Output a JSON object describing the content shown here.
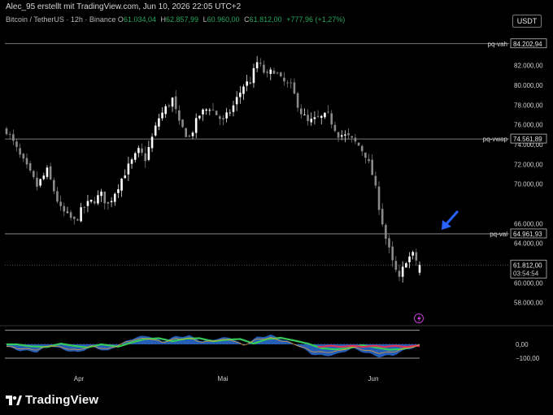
{
  "header": {
    "author_note": "Alec_95 erstellt mit TradingView.com, Jun 10, 2026 22:05 UTC+2",
    "symbol": "Bitcoin / TetherUS · 12h · Binance",
    "ohlc": [
      {
        "key": "O",
        "value": "61.034,04"
      },
      {
        "key": "H",
        "value": "62.857,99"
      },
      {
        "key": "L",
        "value": "60.960,00"
      },
      {
        "key": "C",
        "value": "61.812,00"
      },
      {
        "key": "",
        "value": "+777,96 (+1,27%)"
      }
    ],
    "currency": "USDT"
  },
  "brand": {
    "name": "TradingView"
  },
  "colors": {
    "background": "#000000",
    "up": "#ffffff",
    "down": "#8a8a8a",
    "change": "#26a65b",
    "arrow": "#2962ff",
    "level_line": "#9e9e9e"
  },
  "chart_data": [
    {
      "type": "candlestick",
      "title": "",
      "interval": "12h",
      "x_labels": [
        "Apr",
        "Mai",
        "Jun"
      ],
      "y_ticks": [
        58000,
        60000,
        64000,
        66000,
        70000,
        72000,
        74000,
        76000,
        78000,
        80000,
        82000
      ],
      "y_tick_labels": [
        "58.000,00",
        "60.000,00",
        "64.000,00",
        "66.000,00",
        "70.000,00",
        "72.000,00",
        "74.000,00",
        "76.000,00",
        "78.000,00",
        "80.000,00",
        "82.000,00"
      ],
      "ylim": [
        56000,
        85500
      ],
      "grid": false,
      "price_path": [
        [
          0,
          75500
        ],
        [
          4,
          72800
        ],
        [
          9,
          69800
        ],
        [
          12,
          71300
        ],
        [
          16,
          67400
        ],
        [
          20,
          66200
        ],
        [
          23,
          67700
        ],
        [
          28,
          68900
        ],
        [
          30,
          67900
        ],
        [
          35,
          71200
        ],
        [
          39,
          73300
        ],
        [
          41,
          72600
        ],
        [
          45,
          76700
        ],
        [
          49,
          78600
        ],
        [
          51,
          76000
        ],
        [
          54,
          74700
        ],
        [
          57,
          77000
        ],
        [
          60,
          77800
        ],
        [
          64,
          76300
        ],
        [
          67,
          77900
        ],
        [
          70,
          80000
        ],
        [
          72,
          80400
        ],
        [
          74,
          82300
        ],
        [
          77,
          80900
        ],
        [
          79,
          81600
        ],
        [
          81,
          80500
        ],
        [
          84,
          79800
        ],
        [
          87,
          77300
        ],
        [
          89,
          76200
        ],
        [
          92,
          76600
        ],
        [
          95,
          76900
        ],
        [
          98,
          75100
        ],
        [
          101,
          74700
        ],
        [
          104,
          73900
        ],
        [
          106,
          73000
        ],
        [
          108,
          71000
        ],
        [
          110,
          67800
        ],
        [
          112,
          64500
        ],
        [
          114,
          62000
        ],
        [
          116,
          60300
        ],
        [
          118,
          62400
        ],
        [
          120,
          62800
        ],
        [
          122,
          61800
        ]
      ],
      "levels": [
        {
          "name": "pq-vah",
          "value": 84202.94,
          "label": "84.202,94"
        },
        {
          "name": "pq-vwap",
          "value": 74561.89,
          "label": "74.561,89"
        },
        {
          "name": "pq-val",
          "value": 64961.93,
          "label": "64.961,93"
        }
      ],
      "last_price": {
        "value": 61812.0,
        "label": "61.812,00",
        "countdown": "03:54:54"
      },
      "annotations": [
        {
          "type": "arrow",
          "direction": "down-left",
          "near_level": "pq-val"
        }
      ]
    },
    {
      "type": "line",
      "title": "",
      "y_ticks": [
        0,
        -100
      ],
      "y_tick_labels": [
        "0,00",
        "−100,00"
      ],
      "ylim": [
        -170,
        110
      ],
      "series": [
        {
          "values_path": [
            [
              0,
              -20
            ],
            [
              4,
              -45
            ],
            [
              9,
              -55
            ],
            [
              13,
              -10
            ],
            [
              17,
              -40
            ],
            [
              21,
              -60
            ],
            [
              25,
              -20
            ],
            [
              30,
              -50
            ],
            [
              34,
              5
            ],
            [
              38,
              50
            ],
            [
              42,
              60
            ],
            [
              46,
              20
            ],
            [
              50,
              55
            ],
            [
              54,
              60
            ],
            [
              58,
              20
            ],
            [
              62,
              40
            ],
            [
              66,
              50
            ],
            [
              70,
              -10
            ],
            [
              74,
              50
            ],
            [
              78,
              65
            ],
            [
              82,
              30
            ],
            [
              86,
              -10
            ],
            [
              90,
              -70
            ],
            [
              94,
              -85
            ],
            [
              98,
              -70
            ],
            [
              102,
              -30
            ],
            [
              106,
              -60
            ],
            [
              110,
              -90
            ],
            [
              114,
              -80
            ],
            [
              118,
              -40
            ],
            [
              122,
              -10
            ]
          ]
        }
      ]
    }
  ]
}
